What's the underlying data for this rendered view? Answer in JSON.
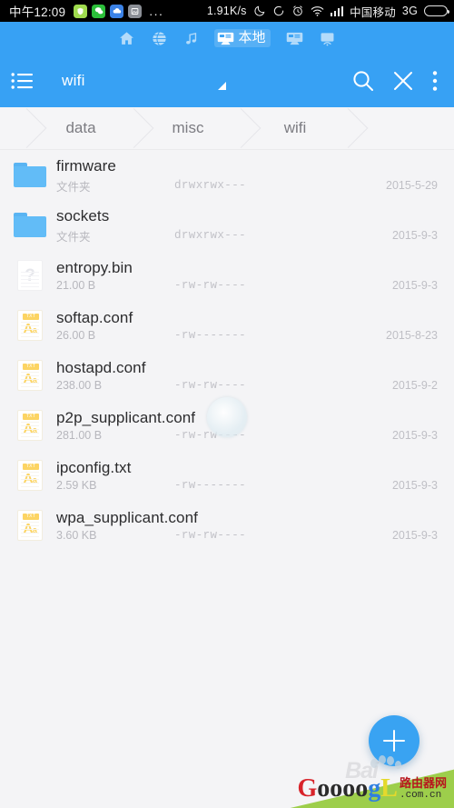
{
  "status_bar": {
    "clock": "中午12:09",
    "app_icons": [
      "shield-app-icon",
      "wechat-app-icon",
      "cloud-app-icon",
      "image-app-icon"
    ],
    "overflow": "...",
    "network_speed": "1.91K/s",
    "icons": [
      "moon-icon",
      "sync-icon",
      "alarm-icon",
      "wifi-icon",
      "signal-icon"
    ],
    "carrier": "中国移动",
    "network_type": "3G",
    "battery": "battery-icon"
  },
  "app_nav": {
    "items": [
      {
        "icon": "home-icon",
        "label": "",
        "active": false
      },
      {
        "icon": "globe-phone-icon",
        "label": "",
        "active": false
      },
      {
        "icon": "music-note-icon",
        "label": "",
        "active": false
      },
      {
        "icon": "local-storage-icon",
        "label": "本地",
        "active": true
      },
      {
        "icon": "remote-storage-icon",
        "label": "",
        "active": false
      },
      {
        "icon": "network-cast-icon",
        "label": "",
        "active": false
      }
    ]
  },
  "toolbar": {
    "menu_icon": "list-menu-icon",
    "title": "wifi",
    "marker_icon": "resize-triangle-icon",
    "search_icon": "search-icon",
    "close_icon": "close-icon",
    "more_icon": "more-vertical-icon"
  },
  "breadcrumb": {
    "items": [
      "data",
      "misc",
      "wifi"
    ]
  },
  "file_list": {
    "rows": [
      {
        "icon": "folder-icon",
        "type": "folder",
        "name": "firmware",
        "size": "文件夹",
        "perm": "drwxrwx---",
        "date": "2015-5-29"
      },
      {
        "icon": "folder-icon",
        "type": "folder",
        "name": "sockets",
        "size": "文件夹",
        "perm": "drwxrwx---",
        "date": "2015-9-3"
      },
      {
        "icon": "unknown-file-icon",
        "type": "unknown",
        "name": "entropy.bin",
        "size": "21.00 B",
        "perm": "-rw-rw----",
        "date": "2015-9-3"
      },
      {
        "icon": "text-file-icon",
        "type": "text",
        "name": "softap.conf",
        "size": "26.00 B",
        "perm": "-rw-------",
        "date": "2015-8-23"
      },
      {
        "icon": "text-file-icon",
        "type": "text",
        "name": "hostapd.conf",
        "size": "238.00 B",
        "perm": "-rw-rw----",
        "date": "2015-9-2"
      },
      {
        "icon": "text-file-icon",
        "type": "text",
        "name": "p2p_supplicant.conf",
        "size": "281.00 B",
        "perm": "-rw-rw----",
        "date": "2015-9-3"
      },
      {
        "icon": "text-file-icon",
        "type": "text",
        "name": "ipconfig.txt",
        "size": "2.59 KB",
        "perm": "-rw-------",
        "date": "2015-9-3"
      },
      {
        "icon": "text-file-icon",
        "type": "text",
        "name": "wpa_supplicant.conf",
        "size": "3.60 KB",
        "perm": "-rw-rw----",
        "date": "2015-9-3"
      }
    ],
    "text_icon_badge": "TXT",
    "text_icon_glyph": "A",
    "text_icon_glyph_small": "a",
    "unknown_icon_glyph": "?"
  },
  "fab": {
    "icon": "plus-icon",
    "label": ""
  },
  "watermark": {
    "baidu_text": "Bai",
    "logo_g": "G",
    "logo_oooo": "oooo",
    "logo_g2": "g",
    "logo_l": "L",
    "site_cn": "路由器网",
    "site_domain": ".com.cn"
  },
  "colors": {
    "accent_blue": "#37a1f4",
    "folder_blue": "#62bcf7",
    "text_icon_yellow": "#fcd462",
    "background": "#f4f4f6",
    "watermark_green": "#9dce4b"
  }
}
